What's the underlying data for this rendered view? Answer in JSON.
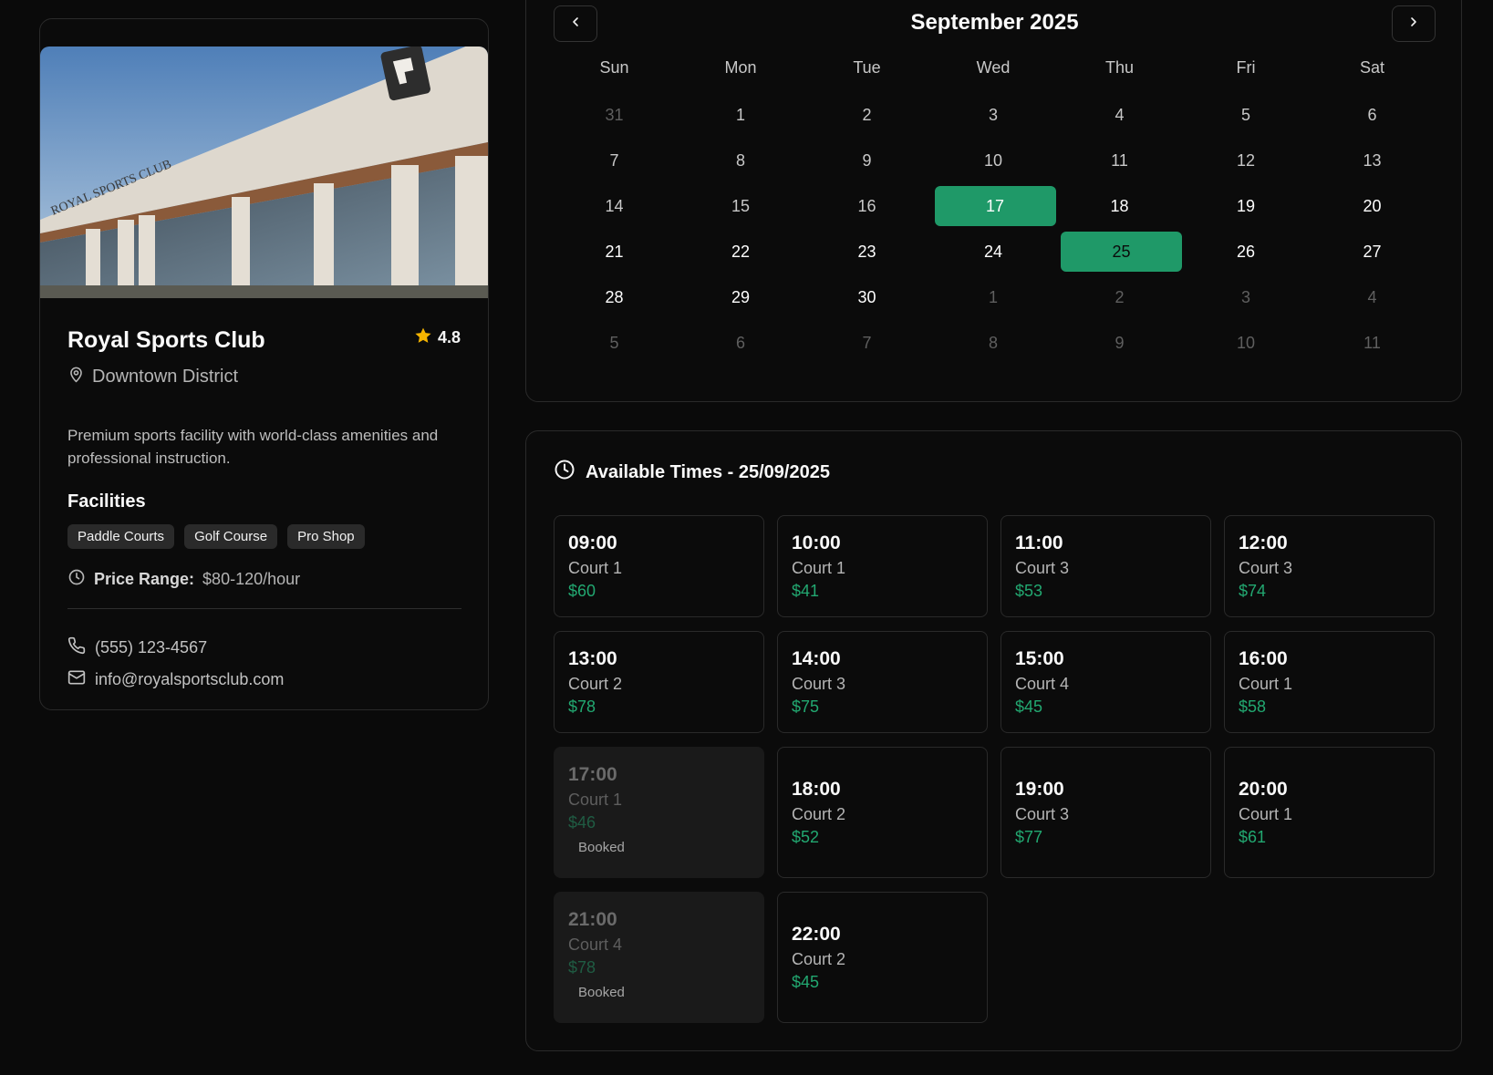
{
  "club": {
    "name": "Royal Sports Club",
    "rating": "4.8",
    "location": "Downtown District",
    "description": "Premium sports facility with world-class amenities and professional instruction.",
    "facilities_title": "Facilities",
    "facilities": [
      "Paddle Courts",
      "Golf Course",
      "Pro Shop"
    ],
    "price_label": "Price Range:",
    "price_value": "$80-120/hour",
    "phone": "(555) 123-4567",
    "email": "info@royalsportsclub.com",
    "building_sign": "ROYAL SPORTS CLUB"
  },
  "calendar": {
    "month_title": "September 2025",
    "weekdays": [
      "Sun",
      "Mon",
      "Tue",
      "Wed",
      "Thu",
      "Fri",
      "Sat"
    ],
    "weeks": [
      [
        {
          "d": "31",
          "s": "muted"
        },
        {
          "d": "1",
          "s": "past"
        },
        {
          "d": "2",
          "s": "past"
        },
        {
          "d": "3",
          "s": "past"
        },
        {
          "d": "4",
          "s": "past"
        },
        {
          "d": "5",
          "s": "past"
        },
        {
          "d": "6",
          "s": "past"
        }
      ],
      [
        {
          "d": "7",
          "s": "past"
        },
        {
          "d": "8",
          "s": "past"
        },
        {
          "d": "9",
          "s": "past"
        },
        {
          "d": "10",
          "s": "past"
        },
        {
          "d": "11",
          "s": "past"
        },
        {
          "d": "12",
          "s": "past"
        },
        {
          "d": "13",
          "s": "past"
        }
      ],
      [
        {
          "d": "14",
          "s": "past"
        },
        {
          "d": "15",
          "s": "past"
        },
        {
          "d": "16",
          "s": "past"
        },
        {
          "d": "17",
          "s": "today"
        },
        {
          "d": "18",
          "s": "normal"
        },
        {
          "d": "19",
          "s": "normal"
        },
        {
          "d": "20",
          "s": "normal"
        }
      ],
      [
        {
          "d": "21",
          "s": "normal"
        },
        {
          "d": "22",
          "s": "normal"
        },
        {
          "d": "23",
          "s": "normal"
        },
        {
          "d": "24",
          "s": "normal"
        },
        {
          "d": "25",
          "s": "selected"
        },
        {
          "d": "26",
          "s": "normal"
        },
        {
          "d": "27",
          "s": "normal"
        }
      ],
      [
        {
          "d": "28",
          "s": "normal"
        },
        {
          "d": "29",
          "s": "normal"
        },
        {
          "d": "30",
          "s": "normal"
        },
        {
          "d": "1",
          "s": "muted"
        },
        {
          "d": "2",
          "s": "muted"
        },
        {
          "d": "3",
          "s": "muted"
        },
        {
          "d": "4",
          "s": "muted"
        }
      ],
      [
        {
          "d": "5",
          "s": "muted"
        },
        {
          "d": "6",
          "s": "muted"
        },
        {
          "d": "7",
          "s": "muted"
        },
        {
          "d": "8",
          "s": "muted"
        },
        {
          "d": "9",
          "s": "muted"
        },
        {
          "d": "10",
          "s": "muted"
        },
        {
          "d": "11",
          "s": "muted"
        }
      ]
    ]
  },
  "times": {
    "title": "Available Times - 25/09/2025",
    "booked_label": "Booked",
    "slots": [
      {
        "time": "09:00",
        "court": "Court 1",
        "price": "$60",
        "booked": false
      },
      {
        "time": "10:00",
        "court": "Court 1",
        "price": "$41",
        "booked": false
      },
      {
        "time": "11:00",
        "court": "Court 3",
        "price": "$53",
        "booked": false
      },
      {
        "time": "12:00",
        "court": "Court 3",
        "price": "$74",
        "booked": false
      },
      {
        "time": "13:00",
        "court": "Court 2",
        "price": "$78",
        "booked": false
      },
      {
        "time": "14:00",
        "court": "Court 3",
        "price": "$75",
        "booked": false
      },
      {
        "time": "15:00",
        "court": "Court 4",
        "price": "$45",
        "booked": false
      },
      {
        "time": "16:00",
        "court": "Court 1",
        "price": "$58",
        "booked": false
      },
      {
        "time": "17:00",
        "court": "Court 1",
        "price": "$46",
        "booked": true
      },
      {
        "time": "18:00",
        "court": "Court 2",
        "price": "$52",
        "booked": false
      },
      {
        "time": "19:00",
        "court": "Court 3",
        "price": "$77",
        "booked": false
      },
      {
        "time": "20:00",
        "court": "Court 1",
        "price": "$61",
        "booked": false
      },
      {
        "time": "21:00",
        "court": "Court 4",
        "price": "$78",
        "booked": true
      },
      {
        "time": "22:00",
        "court": "Court 2",
        "price": "$45",
        "booked": false
      }
    ]
  },
  "colors": {
    "accent": "#1f9968",
    "price_green": "#22a871",
    "star": "#f5b400",
    "background": "#0a0a0a",
    "card_border": "#2a2a2a"
  },
  "icons": {
    "rating": "star-icon",
    "location": "map-pin-icon",
    "price": "clock-icon",
    "phone": "phone-icon",
    "email": "mail-icon",
    "times": "clock-icon",
    "prev": "chevron-left-icon",
    "next": "chevron-right-icon"
  }
}
